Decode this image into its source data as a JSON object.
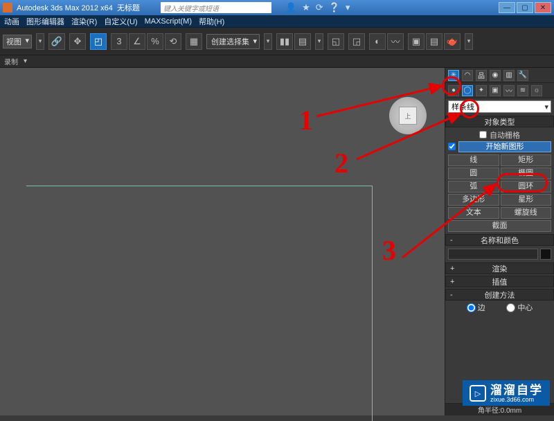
{
  "title": {
    "app": "Autodesk 3ds Max 2012 x64",
    "doc": "无标题"
  },
  "search_placeholder": "键入关键字或短语",
  "menu": [
    "动画",
    "图形编辑器",
    "渲染(R)",
    "自定义(U)",
    "MAXScript(M)",
    "帮助(H)"
  ],
  "toolbar": {
    "view_select": "视图",
    "selection_set": "创建选择集"
  },
  "subbar": {
    "label": "录制"
  },
  "viewcube": {
    "face": "上"
  },
  "panel": {
    "dropdown": "样条线",
    "rollouts": {
      "object_type": "对象类型",
      "name_color": "名称和颜色",
      "render": "渲染",
      "interp": "插值",
      "create_method": "创建方法"
    },
    "autogrid": "自动栅格",
    "start_new": "开始新图形",
    "buttons": {
      "line": "线",
      "rectangle": "矩形",
      "circle": "圆",
      "ellipse": "椭圆",
      "arc": "弧",
      "donut": "圆环",
      "ngon": "多边形",
      "star": "星形",
      "text": "文本",
      "helix": "螺旋线",
      "section": "截面"
    },
    "create_opts": {
      "edge": "边",
      "center": "中心"
    },
    "footer": "角半径:0.0mm"
  },
  "annotations": {
    "n1": "1",
    "n2": "2",
    "n3": "3"
  },
  "watermark": {
    "name": "溜溜自学",
    "url": "zixue.3d66.com"
  }
}
